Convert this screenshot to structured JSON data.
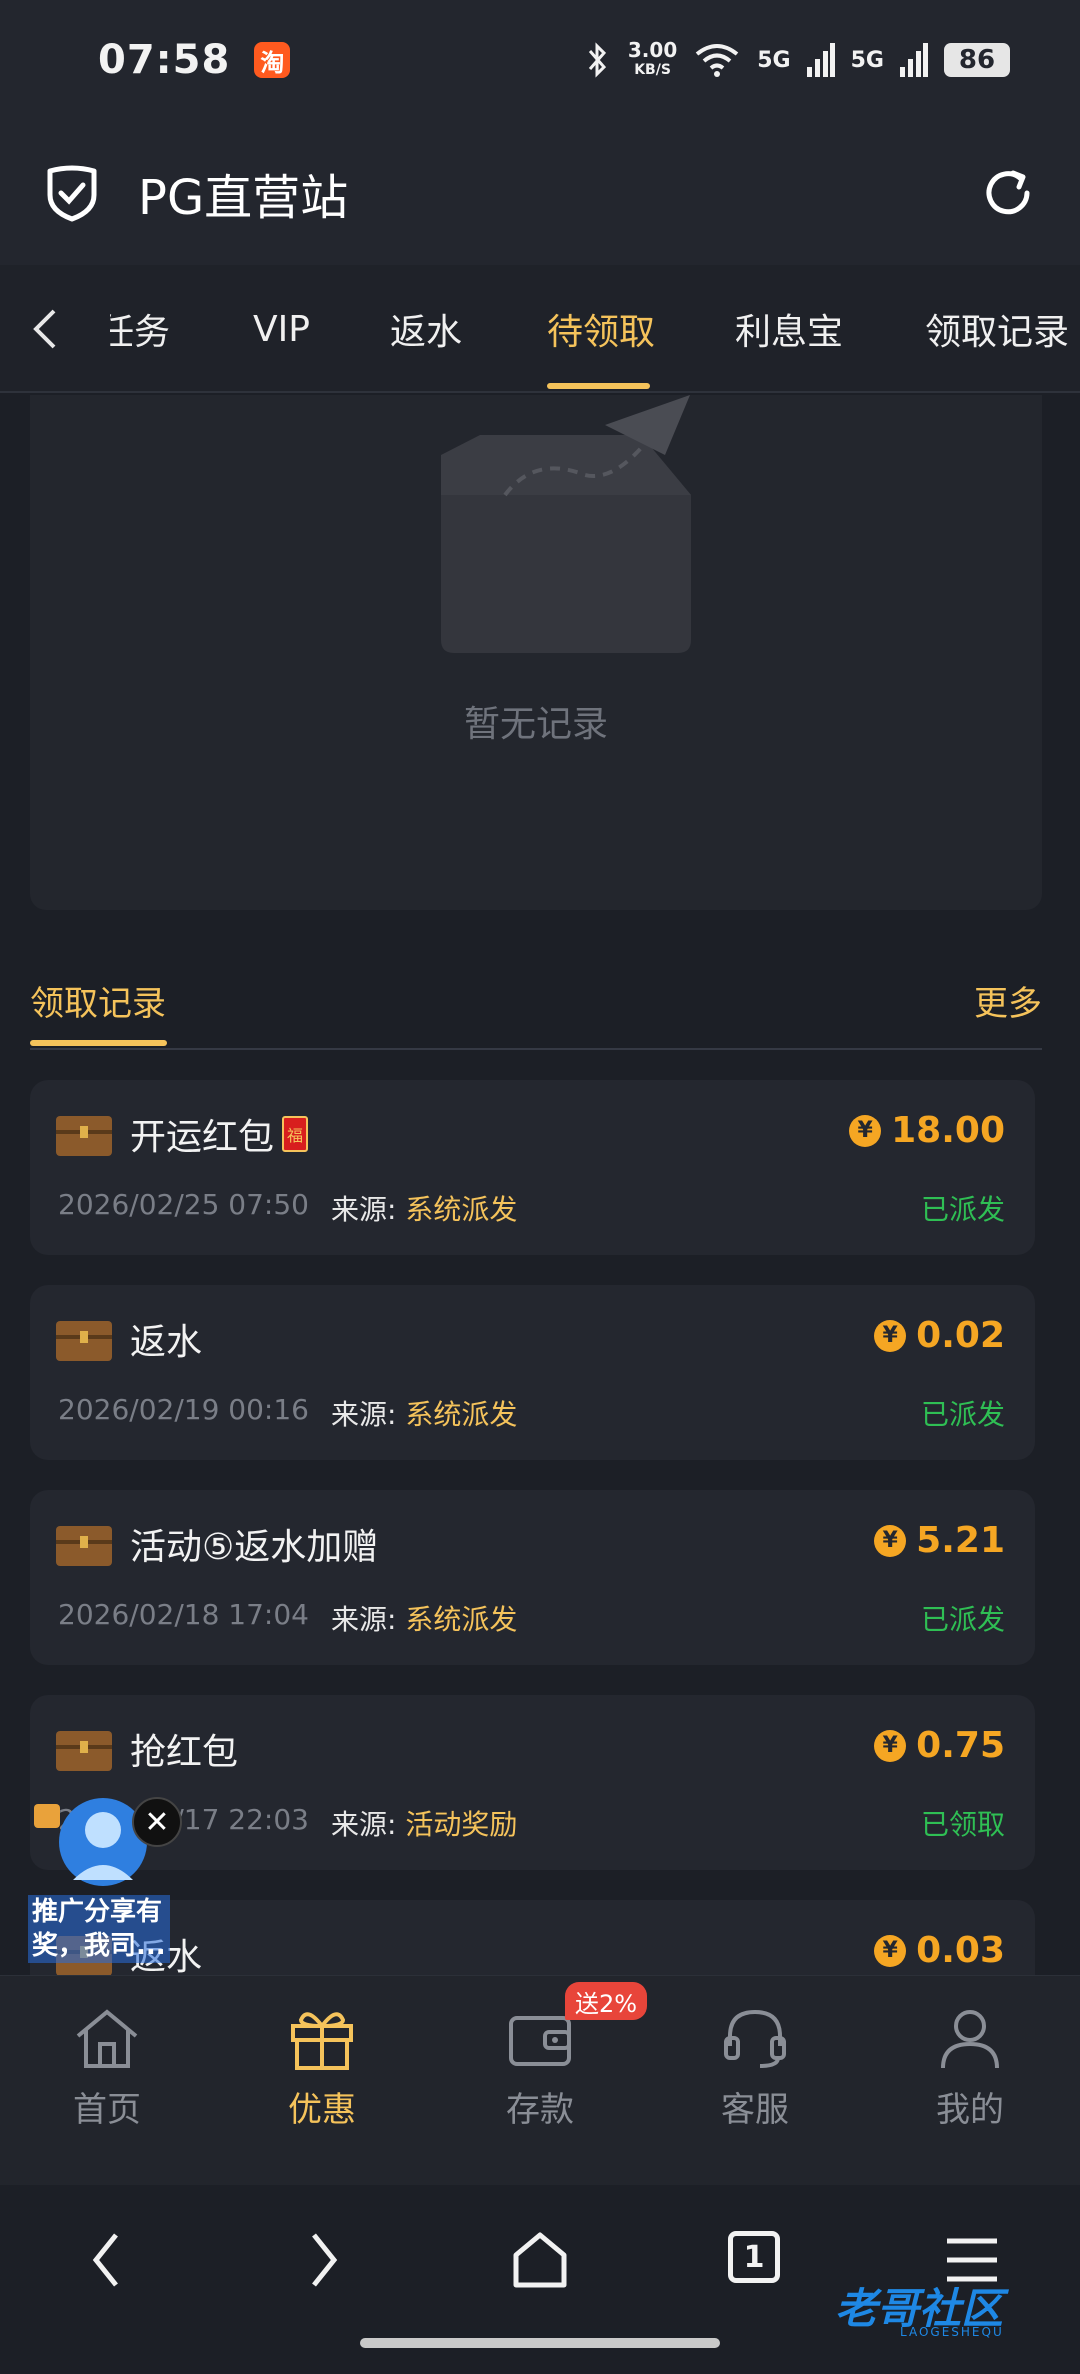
{
  "status_bar": {
    "time": "07:58",
    "net_speed": "3.00",
    "net_unit": "KB/S",
    "signal1": "5G",
    "signal2": "5G",
    "battery": "86"
  },
  "header": {
    "title": "PG直营站"
  },
  "tabs": [
    {
      "label": "任务"
    },
    {
      "label": "VIP"
    },
    {
      "label": "返水"
    },
    {
      "label": "待领取"
    },
    {
      "label": "利息宝"
    },
    {
      "label": "领取记录"
    }
  ],
  "empty_state": {
    "text": "暂无记录"
  },
  "records_section": {
    "title": "领取记录",
    "more": "更多"
  },
  "records": [
    {
      "title": "开运红包",
      "hongbao": "福",
      "amount": "18.00",
      "date": "2026/02/25 07:50",
      "source_label": "来源:",
      "source": "系统派发",
      "status": "已派发"
    },
    {
      "title": "返水",
      "amount": "0.02",
      "date": "2026/02/19 00:16",
      "source_label": "来源:",
      "source": "系统派发",
      "status": "已派发"
    },
    {
      "title": "活动⑤返水加赠",
      "amount": "5.21",
      "date": "2026/02/18 17:04",
      "source_label": "来源:",
      "source": "系统派发",
      "status": "已派发"
    },
    {
      "title": "抢红包",
      "amount": "0.75",
      "date": "2026/02/17 22:03",
      "source_label": "来源:",
      "source": "活动奖励",
      "status": "已领取"
    },
    {
      "title": "返水",
      "amount": "0.03"
    }
  ],
  "currency_symbol": "¥",
  "bottom_nav": [
    {
      "label": "首页"
    },
    {
      "label": "优惠"
    },
    {
      "label": "存款",
      "badge": "送2%"
    },
    {
      "label": "客服"
    },
    {
      "label": "我的"
    }
  ],
  "promo": {
    "text_line1": "推广分享有",
    "text_line2": "奖，我司..."
  },
  "browser": {
    "tab_count": "1"
  },
  "watermark": {
    "text": "老哥社区",
    "sub": "LAOGESHEQU"
  },
  "colors": {
    "accent": "#f5c35b",
    "amount": "#f5a623",
    "success": "#2fbf54",
    "background": "#1c1f26"
  }
}
